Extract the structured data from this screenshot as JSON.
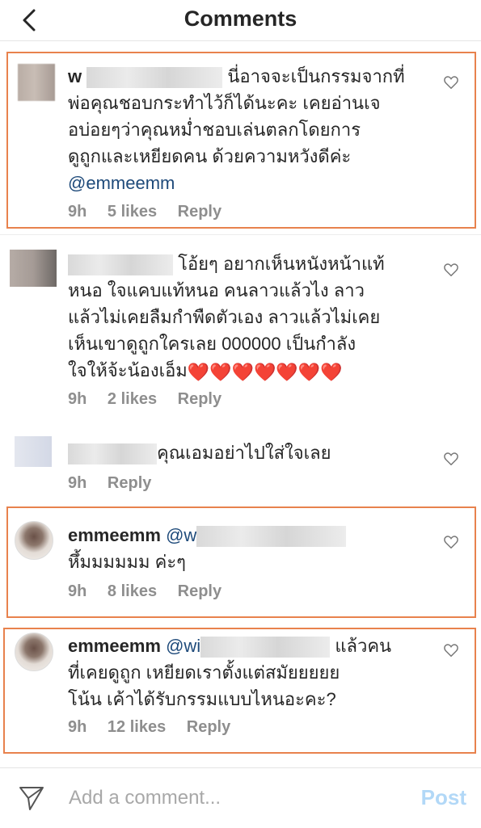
{
  "header": {
    "title": "Comments",
    "back_icon": "chevron-left-icon"
  },
  "comments": [
    {
      "username": "w",
      "text": "นี่อาจจะเป็นกรรมจากที่พ่อคุณชอบกระทำไว้ก็ได้นะคะ เคยอ่านเจอบ่อยๆว่าคุณหม่ำชอบเล่นตลกโดยการดูถูกและเหยียดคน ด้วยความหวังดีค่ะ",
      "line1": "นี่อาจจะเป็นกรรมจากที่",
      "line2": "พ่อคุณชอบกระทำไว้ก็ได้นะคะ เคยอ่านเจ",
      "line3": "อบ่อยๆว่าคุณหม่ำชอบเล่นตลกโดยการ",
      "line4": "ดูถูกและเหยียดคน ด้วยความหวังดีค่ะ",
      "mention": "@emmeemm",
      "time": "9h",
      "likes": "5 likes",
      "reply": "Reply"
    },
    {
      "line1": "โอ้ยๆ อยากเห็นหนังหน้าแท้",
      "line2": "หนอ ใจแคบแท้หนอ คนลาวแล้วไง ลาว",
      "line3": "แล้วไม่เคยลืมกำพืดตัวเอง ลาวแล้วไม่เคย",
      "line4": "เห็นเขาดูถูกใครเลย 000000  เป็นกำลัง",
      "line5": "ใจให้จ้ะน้องเอ็ม",
      "hearts": "❤️❤️❤️❤️❤️❤️❤️",
      "time": "9h",
      "likes": "2 likes",
      "reply": "Reply"
    },
    {
      "text": "คุณเอมอย่าไปใส่ใจเลย",
      "time": "9h",
      "reply": "Reply"
    },
    {
      "username": "emmeemm",
      "mention": "@w",
      "line2": "หึ้มมมมมม ค่ะๆ",
      "time": "9h",
      "likes": "8 likes",
      "reply": "Reply"
    },
    {
      "username": "emmeemm",
      "mention": "@wi",
      "line1_tail": "แล้วคน",
      "line2": "ที่เคยดูถูก เหยียดเราตั้งแต่สมัยยยยย",
      "line3": "โน้น เค้าได้รับกรรมแบบไหนอะคะ?",
      "time": "9h",
      "likes": "12 likes",
      "reply": "Reply"
    }
  ],
  "footer": {
    "placeholder": "Add a comment...",
    "post": "Post",
    "send_icon": "paper-plane-icon"
  },
  "colors": {
    "frame": "#e8824d",
    "mention": "#1e4a7a",
    "post": "#b2d8f7",
    "meta": "#8e8e8e"
  }
}
